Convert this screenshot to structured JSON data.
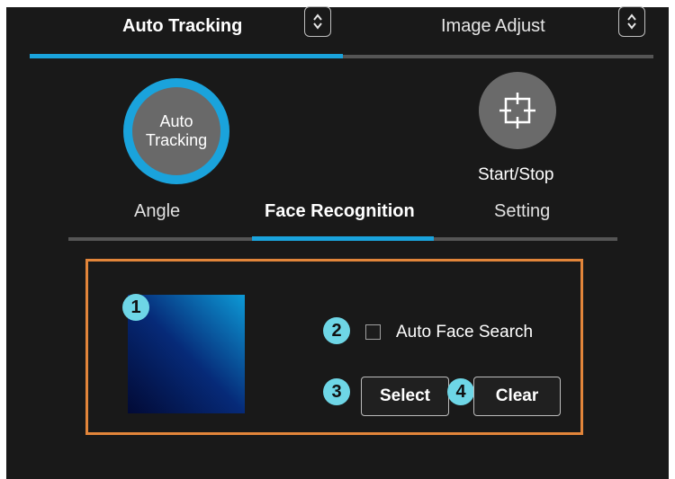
{
  "tabs": [
    {
      "label": "Auto Tracking",
      "active": true
    },
    {
      "label": "Image Adjust",
      "active": false
    }
  ],
  "auto_tracking_button": {
    "line1": "Auto",
    "line2": "Tracking"
  },
  "start_stop": {
    "label": "Start/Stop",
    "icon": "crosshair-frame-icon"
  },
  "subtabs": [
    {
      "label": "Angle",
      "active": false
    },
    {
      "label": "Face Recognition",
      "active": true
    },
    {
      "label": "Setting",
      "active": false
    }
  ],
  "face_panel": {
    "badges": [
      "1",
      "2",
      "3",
      "4"
    ],
    "auto_face_search_label": "Auto Face Search",
    "auto_face_search_checked": false,
    "select_label": "Select",
    "clear_label": "Clear"
  },
  "colors": {
    "background": "#191919",
    "accent": "#1aa3dc",
    "highlight_border": "#e2853a",
    "badge": "#6ed6e6"
  }
}
